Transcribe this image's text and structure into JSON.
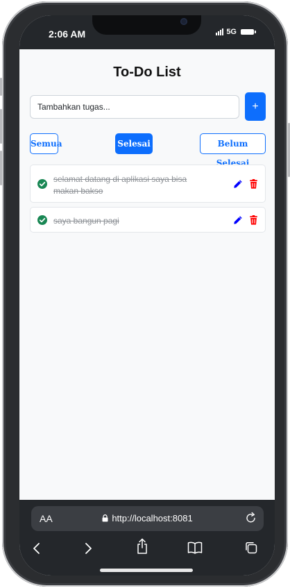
{
  "status": {
    "time": "2:06 AM",
    "network": "5G"
  },
  "app": {
    "title": "To-Do List",
    "input_placeholder": "Tambahkan tugas...",
    "add_label": "+",
    "filters": [
      {
        "label": "Semua",
        "active": false
      },
      {
        "label": "Selesai",
        "active": true
      },
      {
        "label": "Belum Selesai",
        "active": false
      }
    ],
    "todos": [
      {
        "text": "selamat datang di aplikasi saya bisa makan bakso",
        "done": true
      },
      {
        "text": "saya bangun pagi",
        "done": true
      }
    ]
  },
  "browser": {
    "aa_label": "AA",
    "url": "http://localhost:8081"
  },
  "colors": {
    "primary": "#0d6efd",
    "check": "#198754",
    "edit": "#0000ff",
    "delete": "#ff0000",
    "chrome": "#24272b"
  },
  "icons": [
    "check-circle-icon",
    "pencil-icon",
    "trash-icon",
    "lock-icon",
    "reload-icon",
    "back-icon",
    "forward-icon",
    "share-icon",
    "bookmarks-icon",
    "tabs-icon"
  ]
}
